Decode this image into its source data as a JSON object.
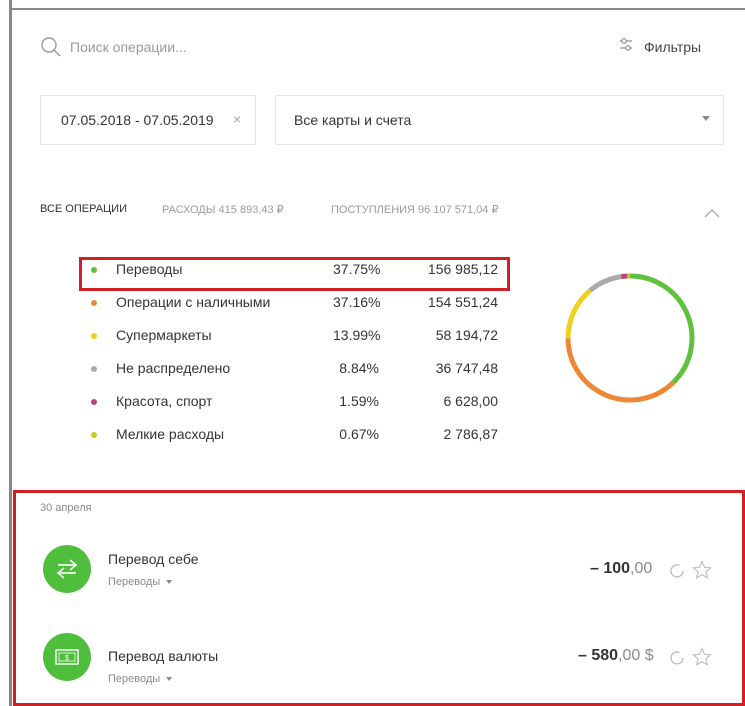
{
  "search": {
    "placeholder": "Поиск операции..."
  },
  "filters": {
    "label": "Фильтры"
  },
  "date_range": {
    "value": "07.05.2018 - 07.05.2019",
    "clear_glyph": "×"
  },
  "account_select": {
    "value": "Все карты и счета"
  },
  "summary": {
    "all": "ВСЕ ОПЕРАЦИИ",
    "expenses": "РАСХОДЫ 415 893,43 ₽",
    "income": "ПОСТУПЛЕНИЯ 96 107 571,04 ₽"
  },
  "chart_data": {
    "type": "pie",
    "categories": [
      "Переводы",
      "Операции с наличными",
      "Супермаркеты",
      "Не распределено",
      "Красота, спорт",
      "Мелкие расходы"
    ],
    "percent_labels": [
      "37.75%",
      "37.16%",
      "13.99%",
      "8.84%",
      "1.59%",
      "0.67%"
    ],
    "amount_labels": [
      "156 985,12",
      "154 551,24",
      "58 194,72",
      "36 747,48",
      "6 628,00",
      "2 786,87"
    ],
    "values": [
      37.75,
      37.16,
      13.99,
      8.84,
      1.59,
      0.67
    ],
    "colors": [
      "#5fc13c",
      "#ee8735",
      "#f2cf1f",
      "#aaaaaa",
      "#b8457a",
      "#c5cf1e"
    ],
    "donut": true
  },
  "date_header": "30 апреля",
  "transactions": [
    {
      "title": "Перевод себе",
      "category": "Переводы",
      "amount_whole": "– 100",
      "amount_frac": ",00",
      "icon": "transfer-arrows-icon"
    },
    {
      "title": "Перевод валюты",
      "category": "Переводы",
      "amount_whole": "– 580",
      "amount_frac": ",00 $",
      "icon": "banknote-icon"
    }
  ]
}
